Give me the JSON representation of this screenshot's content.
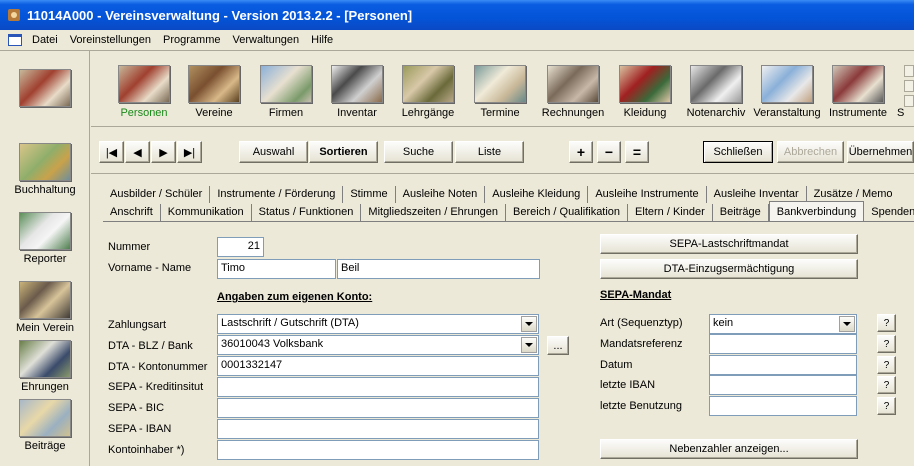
{
  "window": {
    "title": "11014A000 - Vereinsverwaltung - Version 2013.2.2 - [Personen]"
  },
  "menu": [
    "Datei",
    "Voreinstellungen",
    "Programme",
    "Verwaltungen",
    "Hilfe"
  ],
  "leftbar": [
    {
      "label": "Buchhaltung",
      "icon": "money-icon"
    },
    {
      "label": "Reporter",
      "icon": "reporter-icon"
    },
    {
      "label": "Mein Verein",
      "icon": "group-photo-icon"
    },
    {
      "label": "Ehrungen",
      "icon": "award-icon"
    },
    {
      "label": "Beiträge",
      "icon": "banknotes-icon"
    }
  ],
  "toolbar": {
    "home_icon": "home-people-icon",
    "items": [
      {
        "label": "Personen",
        "active": true
      },
      {
        "label": "Vereine"
      },
      {
        "label": "Firmen"
      },
      {
        "label": "Inventar"
      },
      {
        "label": "Lehrgänge"
      },
      {
        "label": "Termine"
      },
      {
        "label": "Rechnungen"
      },
      {
        "label": "Kleidung"
      },
      {
        "label": "Notenarchiv"
      },
      {
        "label": "Veranstaltung"
      },
      {
        "label": "Instrumente"
      },
      {
        "label": "S"
      }
    ]
  },
  "nav": {
    "first": "|◀",
    "prev": "◀",
    "next": "▶",
    "last": "▶|",
    "auswahl": "Auswahl",
    "sortieren": "Sortieren",
    "suche": "Suche",
    "liste": "Liste",
    "plus": "+",
    "minus": "−",
    "equals": "=",
    "schliessen": "Schließen",
    "abbrechen": "Abbrechen",
    "uebernehmen": "Übernehmen"
  },
  "tabs_row1": [
    "Ausbilder / Schüler",
    "Instrumente / Förderung",
    "Stimme",
    "Ausleihe Noten",
    "Ausleihe Kleidung",
    "Ausleihe Instrumente",
    "Ausleihe Inventar",
    "Zusätze / Memo"
  ],
  "tabs_row2": [
    "Anschrift",
    "Kommunikation",
    "Status / Funktionen",
    "Mitgliedszeiten / Ehrungen",
    "Bereich / Qualifikation",
    "Eltern / Kinder",
    "Beiträge",
    "Bankverbindung",
    "Spenden / A"
  ],
  "form": {
    "nummer_label": "Nummer",
    "nummer": "21",
    "name_label": "Vorname - Name",
    "vorname": "Timo",
    "nachname": "Beil",
    "konto_heading": "Angaben zum eigenen Konto:",
    "zahlungsart_label": "Zahlungsart",
    "zahlungsart": "Lastschrift / Gutschrift (DTA)",
    "blz_label": "DTA - BLZ / Bank",
    "blz": "36010043  Volksbank",
    "blz_btn": "...",
    "kontonummer_label": "DTA - Kontonummer",
    "kontonummer": "0001332147",
    "kreditinstitut_label": "SEPA - Kreditinsitut",
    "kreditinstitut": "",
    "bic_label": "SEPA - BIC",
    "bic": "",
    "iban_label": "SEPA - IBAN",
    "iban": "",
    "inhaber_label": "Kontoinhaber *)",
    "inhaber": ""
  },
  "sepa": {
    "lastschrift_btn": "SEPA-Lastschriftmandat",
    "dta_btn": "DTA-Einzugsermächtigung",
    "heading": "SEPA-Mandat",
    "art_label": "Art (Sequenztyp)",
    "art": "kein",
    "referenz_label": "Mandatsreferenz",
    "referenz": "",
    "datum_label": "Datum",
    "datum": "",
    "letzte_iban_label": "letzte IBAN",
    "letzte_iban": "",
    "letzte_benutzung_label": "letzte Benutzung",
    "letzte_benutzung": "",
    "help": "?",
    "nebenzahler_btn": "Nebenzahler anzeigen..."
  }
}
